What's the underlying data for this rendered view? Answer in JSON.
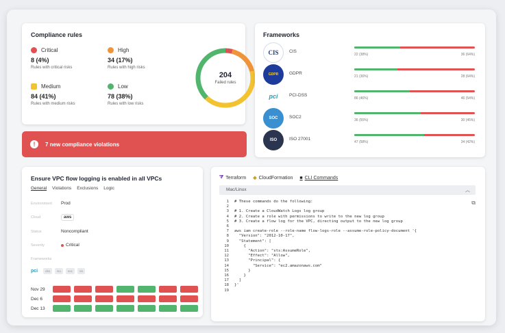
{
  "compliance": {
    "title": "Compliance rules",
    "risks": [
      {
        "label": "Critical",
        "count": "8 (4%)",
        "sub": "Rules with critical risks",
        "color": "#e05252"
      },
      {
        "label": "High",
        "count": "34 (17%)",
        "sub": "Rules with high risks",
        "color": "#f0943a"
      },
      {
        "label": "Medium",
        "count": "84 (41%)",
        "sub": "Rules with medium risks",
        "color": "#f2c230"
      },
      {
        "label": "Low",
        "count": "78 (38%)",
        "sub": "Rules with low risks",
        "color": "#52b56e"
      }
    ],
    "donut": {
      "total": "204",
      "label": "Failed rules",
      "fractions": [
        0.04,
        0.17,
        0.41,
        0.38
      ]
    }
  },
  "banner": {
    "icon": "alert-icon",
    "text": "7 new compliance violations"
  },
  "frameworks": {
    "title": "Frameworks",
    "items": [
      {
        "name": "CIS",
        "logo": "CIS",
        "pass": "22 (38%)",
        "fail": "36 (64%)",
        "pass_fraction": 0.38
      },
      {
        "name": "GDPR",
        "logo": "GDPR",
        "pass": "21 (36%)",
        "fail": "28 (64%)",
        "pass_fraction": 0.36
      },
      {
        "name": "PCI-DSS",
        "logo": "pci",
        "pass": "86 (46%)",
        "fail": "46 (54%)",
        "pass_fraction": 0.46
      },
      {
        "name": "SOC2",
        "logo": "SOC",
        "pass": "36 (55%)",
        "fail": "30 (45%)",
        "pass_fraction": 0.55
      },
      {
        "name": "ISO 27001",
        "logo": "ISO",
        "pass": "47 (58%)",
        "fail": "34 (42%)",
        "pass_fraction": 0.58
      }
    ]
  },
  "detail": {
    "title": "Ensure VPC flow logging is enabled in all VPCs",
    "tabs": [
      "General",
      "Violations",
      "Exclusions",
      "Logic"
    ],
    "active_tab": "General",
    "fields": [
      {
        "key": "Environment",
        "value": "Prod"
      },
      {
        "key": "Cloud",
        "value": "aws"
      },
      {
        "key": "Status",
        "value": "Noncompliant"
      },
      {
        "key": "Severity",
        "value": "Critical"
      }
    ],
    "frameworks_label": "Frameworks",
    "chips": [
      "pci",
      "dss",
      "iso",
      "soc",
      "cis"
    ],
    "history": [
      {
        "date": "Nov 29",
        "cells": [
          "fail",
          "fail",
          "fail",
          "pass",
          "pass",
          "fail",
          "fail"
        ]
      },
      {
        "date": "Dec 6",
        "cells": [
          "fail",
          "fail",
          "fail",
          "fail",
          "fail",
          "fail",
          "fail"
        ]
      },
      {
        "date": "Dec 13",
        "cells": [
          "pass",
          "pass",
          "pass",
          "pass",
          "pass",
          "pass",
          "pass"
        ]
      }
    ]
  },
  "cli": {
    "tabs": [
      {
        "label": "Terraform",
        "icon": "terraform-icon"
      },
      {
        "label": "CloudFormation",
        "icon": "cloudformation-icon"
      },
      {
        "label": "CLI Commands",
        "icon": "terminal-icon"
      }
    ],
    "active_tab": "CLI Commands",
    "os": "Mac/Linux",
    "lines": [
      "# These commands do the following:",
      "",
      "# 1. Create a CloudWatch Logs log group",
      "# 2. Create a role with permissions to write to the new log group",
      "# 3. Create a flow log for the VPC, directing output to the new log group",
      "",
      "aws iam create-role --role-name flow-logs-role --assume-role-policy-document '{",
      "  \"Version\": \"2012-10-17\",",
      "  \"Statement\": [",
      "    {",
      "      \"Action\": \"sts:AssumeRole\",",
      "      \"Effect\": \"Allow\",",
      "      \"Principal\": {",
      "        \"Service\": \"ec2.amazonaws.com\"",
      "      }",
      "    }",
      "  ]",
      "}'",
      ""
    ]
  },
  "colors": {
    "pass": "#52b56e",
    "fail": "#e05252"
  }
}
